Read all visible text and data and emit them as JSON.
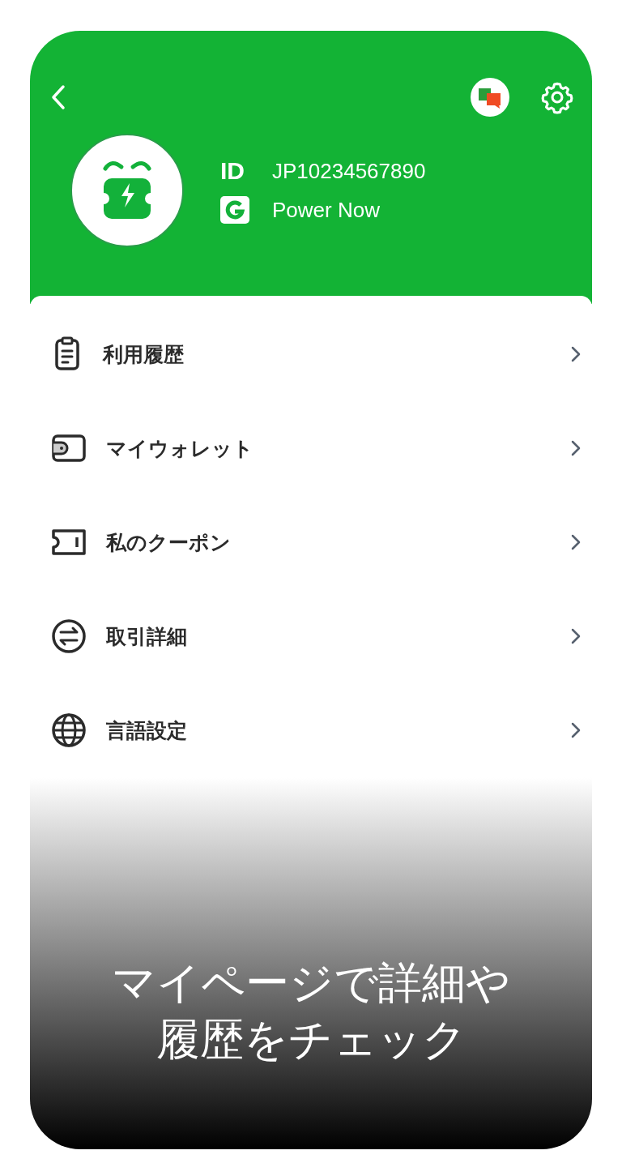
{
  "profile": {
    "id_label": "ID",
    "id_value": "JP10234567890",
    "provider_value": "Power Now"
  },
  "menu": [
    {
      "label": "利用履歴"
    },
    {
      "label": "マイウォレット"
    },
    {
      "label": "私のクーポン"
    },
    {
      "label": "取引詳細"
    },
    {
      "label": "言語設定"
    }
  ],
  "caption": [
    "マイページで詳細や",
    "履歴をチェック"
  ]
}
